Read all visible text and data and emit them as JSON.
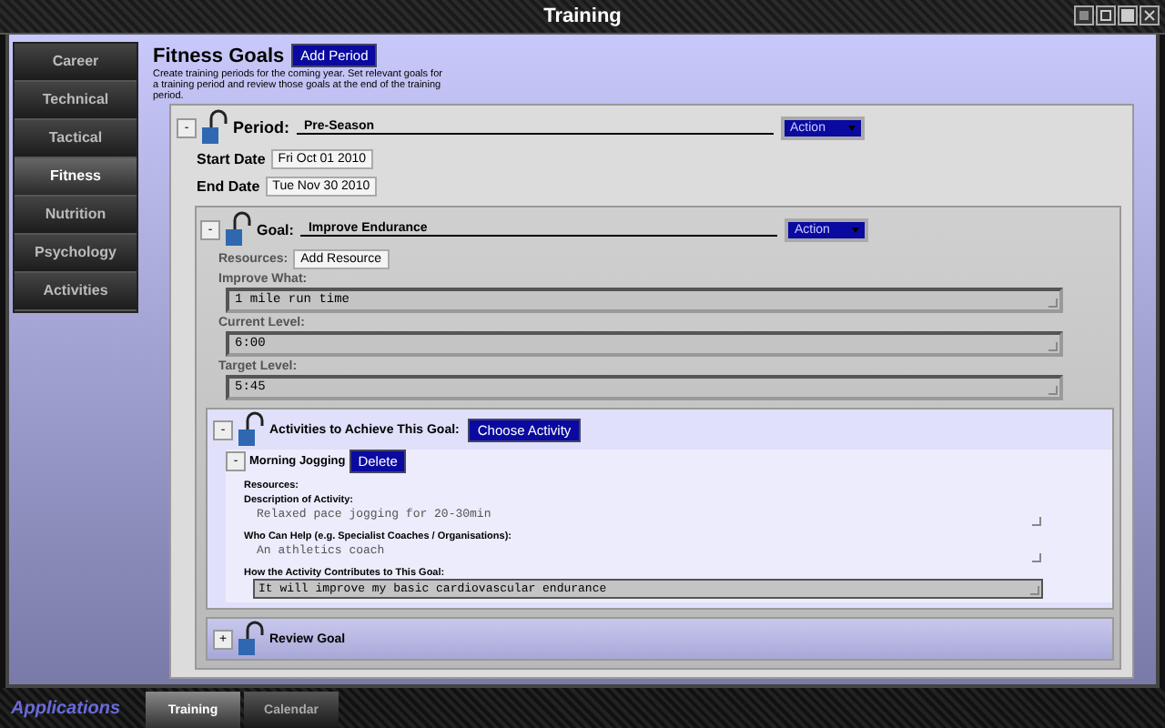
{
  "window": {
    "title": "Training"
  },
  "sidebar": {
    "items": [
      {
        "label": "Career",
        "selected": false
      },
      {
        "label": "Technical",
        "selected": false
      },
      {
        "label": "Tactical",
        "selected": false
      },
      {
        "label": "Fitness",
        "selected": true
      },
      {
        "label": "Nutrition",
        "selected": false
      },
      {
        "label": "Psychology",
        "selected": false
      },
      {
        "label": "Activities",
        "selected": false
      }
    ]
  },
  "content": {
    "heading": "Fitness Goals",
    "add_button": "Add Period",
    "description": "Create training periods for the coming year. Set relevant goals for a training period and review those goals at the end of the training period.",
    "period": {
      "toggle": "-",
      "label": "Period:",
      "name": "Pre-Season",
      "action": "Action",
      "start_label": "Start Date",
      "start_date": "Fri Oct 01 2010",
      "end_label": "End Date",
      "end_date": "Tue Nov 30 2010",
      "goal": {
        "toggle": "-",
        "label": "Goal:",
        "name": "Improve Endurance",
        "action": "Action",
        "resources_label": "Resources:",
        "resource_button": "Add Resource",
        "fields": [
          {
            "label": "Improve What:",
            "value": "1 mile run time"
          },
          {
            "label": "Current Level:",
            "value": "6:00"
          },
          {
            "label": "Target Level:",
            "value": "5:45"
          }
        ],
        "activities": {
          "toggle": "-",
          "title": "Activities to Achieve This Goal:",
          "choose_button": "Choose Activity",
          "items": [
            {
              "toggle": "-",
              "name": "Morning Jogging",
              "delete_button": "Delete",
              "resources_label": "Resources:",
              "fields": [
                {
                  "kind": "plain",
                  "label": "Description of Activity:",
                  "value": "Relaxed pace jogging for 20-30min"
                },
                {
                  "kind": "plain",
                  "label": "Who Can Help (e.g. Specialist Coaches / Organisations):",
                  "value": "An athletics coach"
                },
                {
                  "kind": "boxed",
                  "label": "How the Activity Contributes to This Goal:",
                  "value": "It will improve my basic cardiovascular endurance"
                }
              ]
            }
          ]
        },
        "review": {
          "toggle": "+",
          "title": "Review Goal"
        }
      }
    }
  },
  "taskbar": {
    "brand": "Applications",
    "tabs": [
      {
        "label": "Training",
        "selected": true
      },
      {
        "label": "Calendar",
        "selected": false
      }
    ]
  }
}
